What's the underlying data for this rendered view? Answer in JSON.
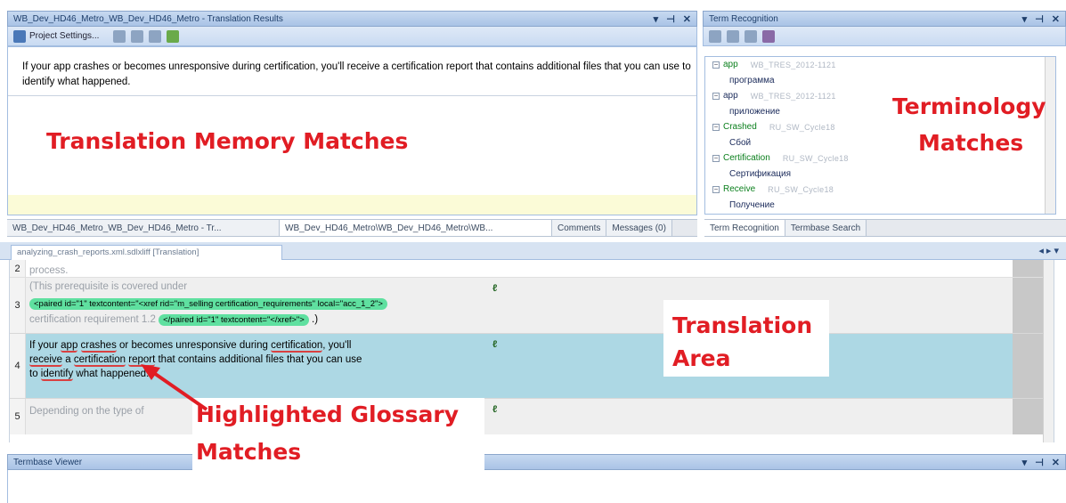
{
  "translation_results": {
    "title": "WB_Dev_HD46_Metro_WB_Dev_HD46_Metro - Translation Results",
    "toolbar_label": "Project Settings...",
    "source_text": "If your app crashes or becomes unresponsive during certification, you'll receive a certification report that contains additional files that you can use to identify what happened.",
    "overlay_label": "Translation Memory Matches"
  },
  "term_recognition": {
    "title": "Term Recognition",
    "overlay_label_line1": "Terminology",
    "overlay_label_line2": "Matches",
    "terms": [
      {
        "source": "app",
        "meta": "WB_TRES_2012-1121",
        "target": "программа"
      },
      {
        "source": "app",
        "meta": "WB_TRES_2012-1121",
        "target": "приложение"
      },
      {
        "source": "Crashed",
        "meta": "RU_SW_Cycle18",
        "target": "Сбой"
      },
      {
        "source": "Certification",
        "meta": "RU_SW_Cycle18",
        "target": "Сертификация"
      },
      {
        "source": "Receive",
        "meta": "RU_SW_Cycle18",
        "target": "Получение"
      }
    ],
    "tabs": [
      "Term Recognition",
      "Termbase Search"
    ]
  },
  "bottom_tabs": [
    "WB_Dev_HD46_Metro_WB_Dev_HD46_Metro - Tr...",
    "WB_Dev_HD46_Metro\\WB_Dev_HD46_Metro\\WB...",
    "Comments",
    "Messages (0)"
  ],
  "document_tab": "analyzing_crash_reports.xml.sdlxliff [Translation]",
  "segments": {
    "seg2_text": "process.",
    "seg3_line1": "(This prerequisite is covered under",
    "seg3_tag1": "<paired id=\"1\" textcontent=\"<xref rid=\"m_selling certification_requirements\" local=\"acc_1_2\">",
    "seg3_line3": "certification requirement 1.2",
    "seg3_tag2": "</paired id=\"1\" textcontent=\"</xref>\">",
    "seg3_end": ".)",
    "seg4": {
      "w1": "If your ",
      "app": "app",
      "w2": " ",
      "crashes": "crashes",
      "w3": " or becomes unresponsive during ",
      "certification1": "certification",
      "w4": ", you'll",
      "receive": "receive",
      "w5": " a ",
      "certification2": "certification",
      "w6": " ",
      "report": "report",
      "w7": " that contains additional files that you can use",
      "w8": "to ",
      "identify": "identify",
      "w9": " what happened."
    },
    "seg5_text": "Depending on the type of",
    "numbers": [
      "2",
      "3",
      "4",
      "5"
    ]
  },
  "labels": {
    "translation_area_line1": "Translation",
    "translation_area_line2": "Area",
    "glossary_line1": "Highlighted Glossary",
    "glossary_line2": "Matches"
  },
  "termbase_viewer": {
    "title": "Termbase Viewer"
  },
  "colors": {
    "accent_red": "#e11d24",
    "active_row": "#add8e4",
    "tag_green": "#5fe0a0",
    "term_green": "#0a7f1c"
  }
}
